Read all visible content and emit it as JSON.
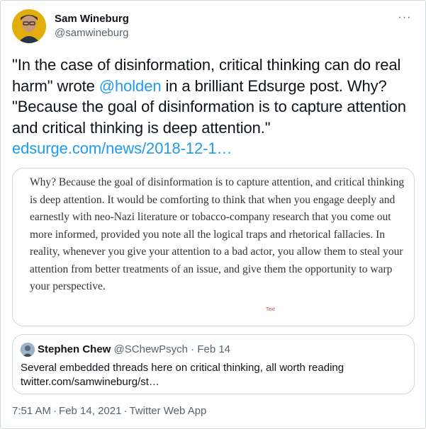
{
  "author": {
    "name": "Sam Wineburg",
    "handle": "@samwineburg"
  },
  "more_icon": "more-dots-icon",
  "tweet": {
    "text_1": "\"In the case of disinformation, critical thinking can do real harm\" wrote ",
    "mention": "@holden",
    "text_2": " in a brilliant Edsurge post. Why? \"Because the goal of disinformation is to capture attention and critical thinking is deep attention.\" ",
    "link": "edsurge.com/news/2018-12-1…"
  },
  "media": {
    "text": "Why? Because the goal of disinformation is to capture attention, and critical thinking is deep attention. It would be comforting to think that when you engage deeply and earnestly with neo-Nazi literature or tobacco-company research that you come out more informed, provided you note all the logical traps and rhetorical fallacies. In reality, whenever you give your attention to a bad actor, you allow them to steal your attention from better treatments of an issue, and give them the opportunity to warp your perspective.",
    "mark": "Text"
  },
  "quote": {
    "name": "Stephen Chew",
    "handle": "@SChewPsych",
    "separator": "·",
    "date": "Feb 14",
    "body_line_1": "Several embedded threads here on critical thinking, all worth reading",
    "body_line_2": "twitter.com/samwineburg/st…"
  },
  "footer": {
    "time": "7:51 AM",
    "date": "Feb 14, 2021",
    "source": "Twitter Web App",
    "separator": "·"
  }
}
